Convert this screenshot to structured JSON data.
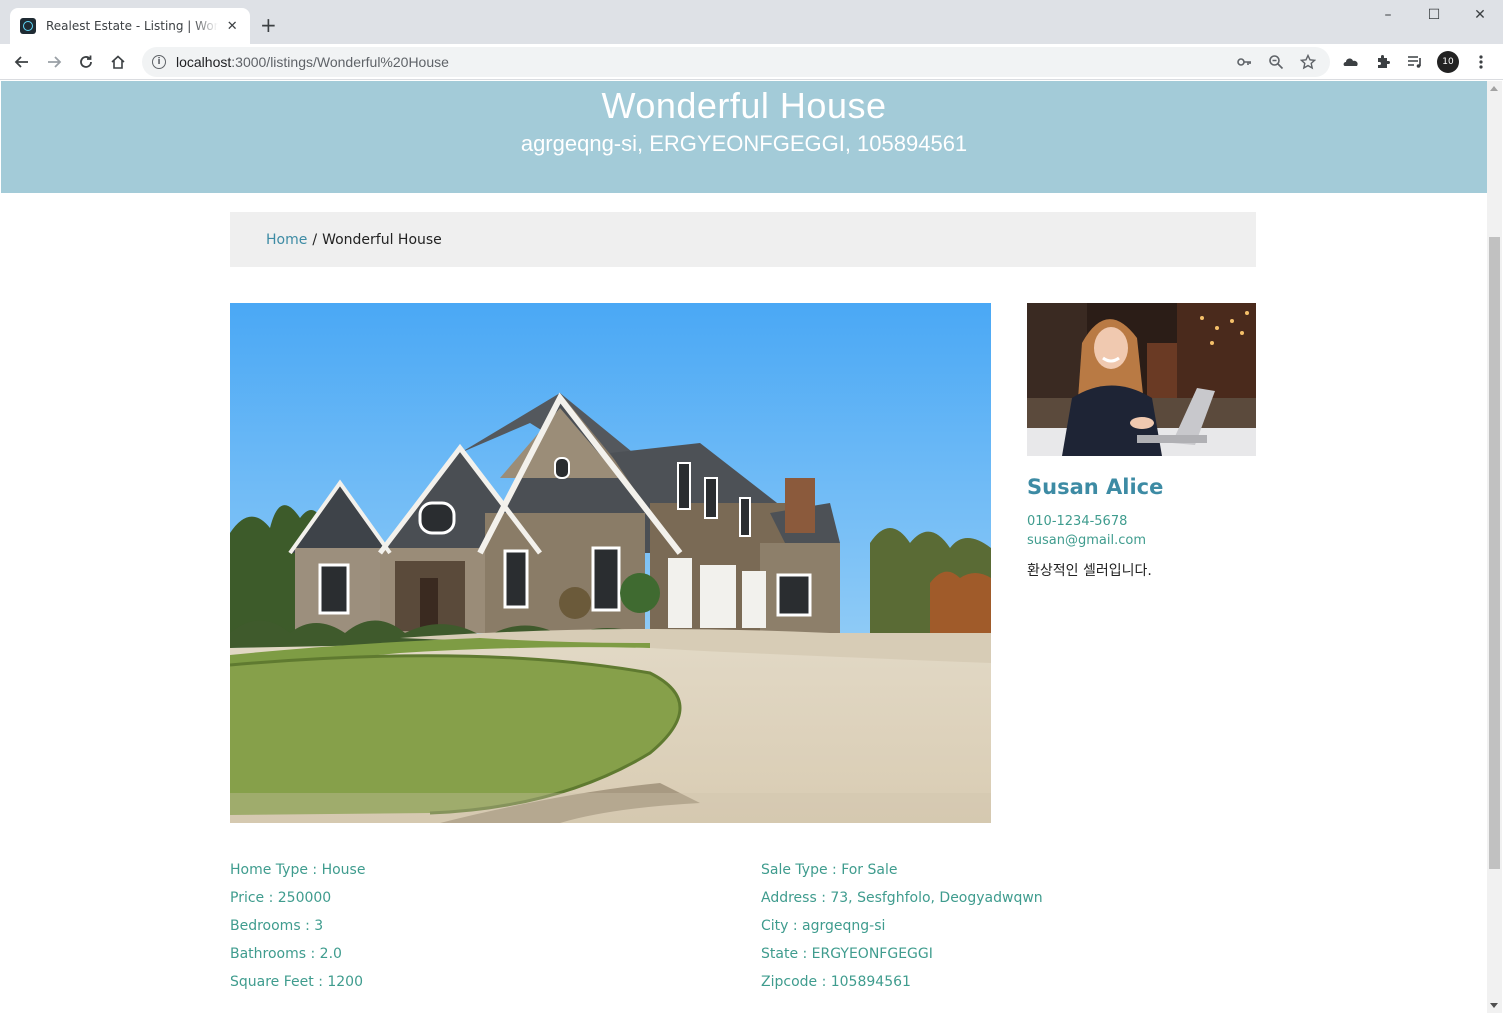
{
  "browser": {
    "tab_title": "Realest Estate - Listing | Wonderful House",
    "new_tab_symbol": "+",
    "url_host": "localhost",
    "url_rest": ":3000/listings/Wonderful%20House",
    "window_controls": [
      "–",
      "☐",
      "✕"
    ],
    "extension_badge": "10"
  },
  "hero": {
    "title": "Wonderful House",
    "subtitle": "agrgeqng-si, ERGYEONFGEGGI, 105894561"
  },
  "breadcrumb": {
    "home": "Home",
    "separator": "/",
    "current": "Wonderful House"
  },
  "realtor": {
    "name": "Susan Alice",
    "phone": "010-1234-5678",
    "email": "susan@gmail.com",
    "description": "환상적인 셀러입니다."
  },
  "details": {
    "left": [
      "Home Type : House",
      "Price : 250000",
      "Bedrooms : 3",
      "Bathrooms : 2.0",
      "Square Feet : 1200"
    ],
    "right": [
      "Sale Type : For Sale",
      "Address : 73, Sesfghfolo, Deogyadwqwn",
      "City : agrgeqng-si",
      "State : ERGYEONFGEGGI",
      "Zipcode : 105894561"
    ]
  },
  "colors": {
    "hero_bg": "#a3cbd8",
    "link": "#3d8ba4",
    "detail_text": "#3f9c8e"
  }
}
